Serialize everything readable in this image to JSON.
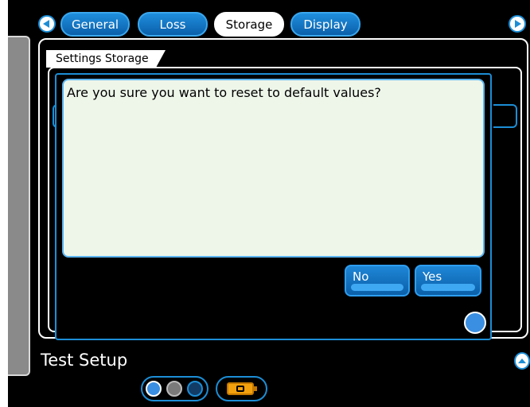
{
  "tabs": [
    {
      "label": "General"
    },
    {
      "label": "Loss"
    },
    {
      "label": "Storage"
    },
    {
      "label": "Display"
    }
  ],
  "active_tab": "Storage",
  "section": {
    "title": "Settings Storage"
  },
  "dialog": {
    "message": "Are you sure you want to reset to default values?",
    "buttons": {
      "no": "No",
      "yes": "Yes"
    }
  },
  "footer": {
    "title": "Test Setup"
  },
  "colors": {
    "accent": "#1c8ed6",
    "battery": "#f3a10d"
  },
  "icons": [
    "nav-left-icon",
    "nav-right-icon",
    "scroll-up-icon",
    "lock-icon",
    "info-icon",
    "battery-icon"
  ]
}
